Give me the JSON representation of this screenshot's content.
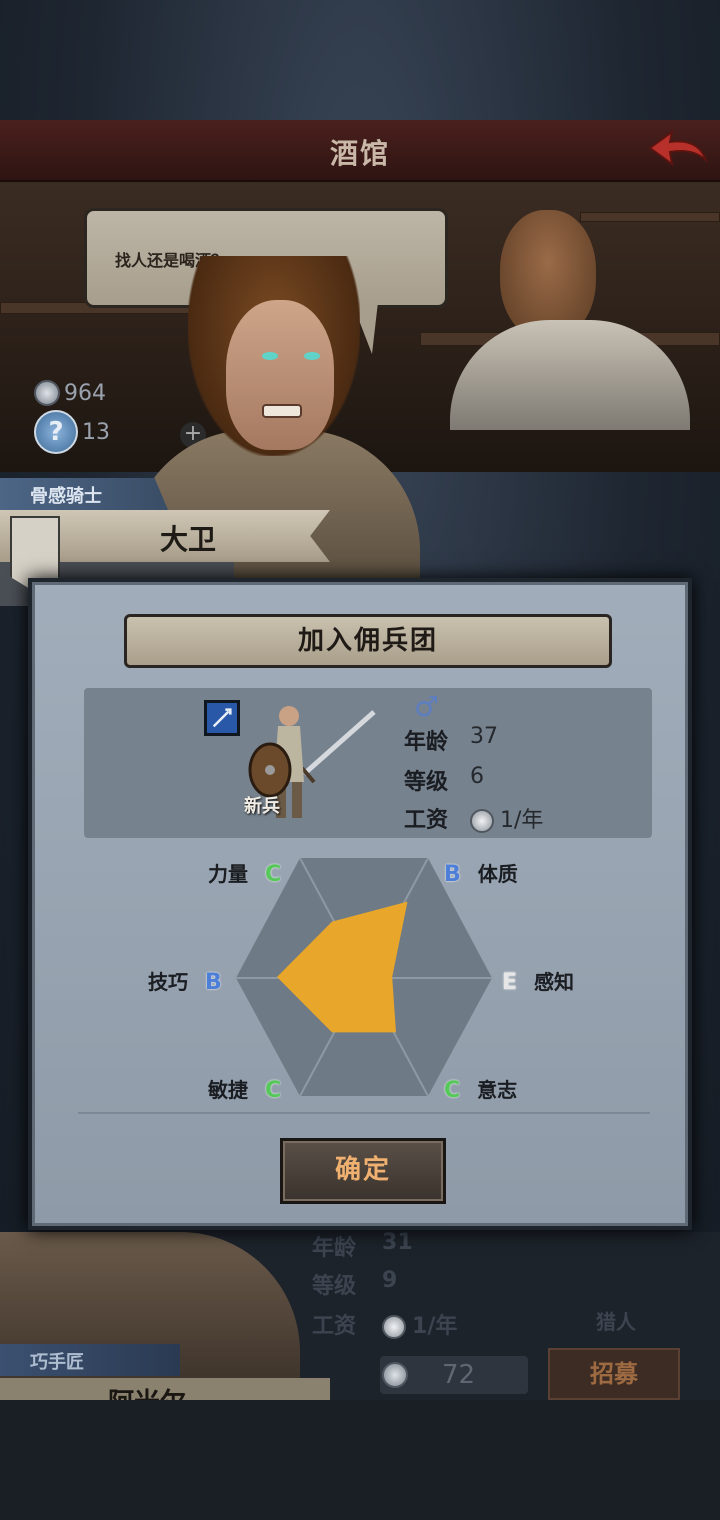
{
  "header": {
    "title": "酒馆"
  },
  "dialog": {
    "text": "找人还是喝酒？"
  },
  "resources": {
    "coins": "964",
    "tokens": "13"
  },
  "candidate": {
    "class": "骨感骑士",
    "name": "大卫"
  },
  "modal": {
    "title": "加入佣兵团",
    "rank": "新兵",
    "gender_symbol": "♂",
    "stats": [
      {
        "label": "年龄",
        "value": "37"
      },
      {
        "label": "等级",
        "value": "6"
      },
      {
        "label": "工资",
        "value": "1/年"
      }
    ],
    "attributes": {
      "strength": {
        "label": "力量",
        "grade": "C"
      },
      "constitution": {
        "label": "体质",
        "grade": "B"
      },
      "skill": {
        "label": "技巧",
        "grade": "B"
      },
      "perception": {
        "label": "感知",
        "grade": "E"
      },
      "agility": {
        "label": "敏捷",
        "grade": "C"
      },
      "willpower": {
        "label": "意志",
        "grade": "C"
      }
    },
    "confirm_label": "确定"
  },
  "next_candidate": {
    "class": "巧手匠",
    "name": "阿米尔",
    "stats": [
      {
        "label": "年龄",
        "value": "31"
      },
      {
        "label": "等级",
        "value": "9"
      },
      {
        "label": "工资",
        "value": "1/年"
      }
    ],
    "role": "猎人",
    "price": "72",
    "recruit_label": "招募"
  },
  "colors": {
    "grade_C": "#57c85a",
    "grade_B": "#4e7fd8",
    "grade_E": "#e6e6e6",
    "radar_fill": "#e8a62a",
    "confirm_text": "#f0b070"
  }
}
